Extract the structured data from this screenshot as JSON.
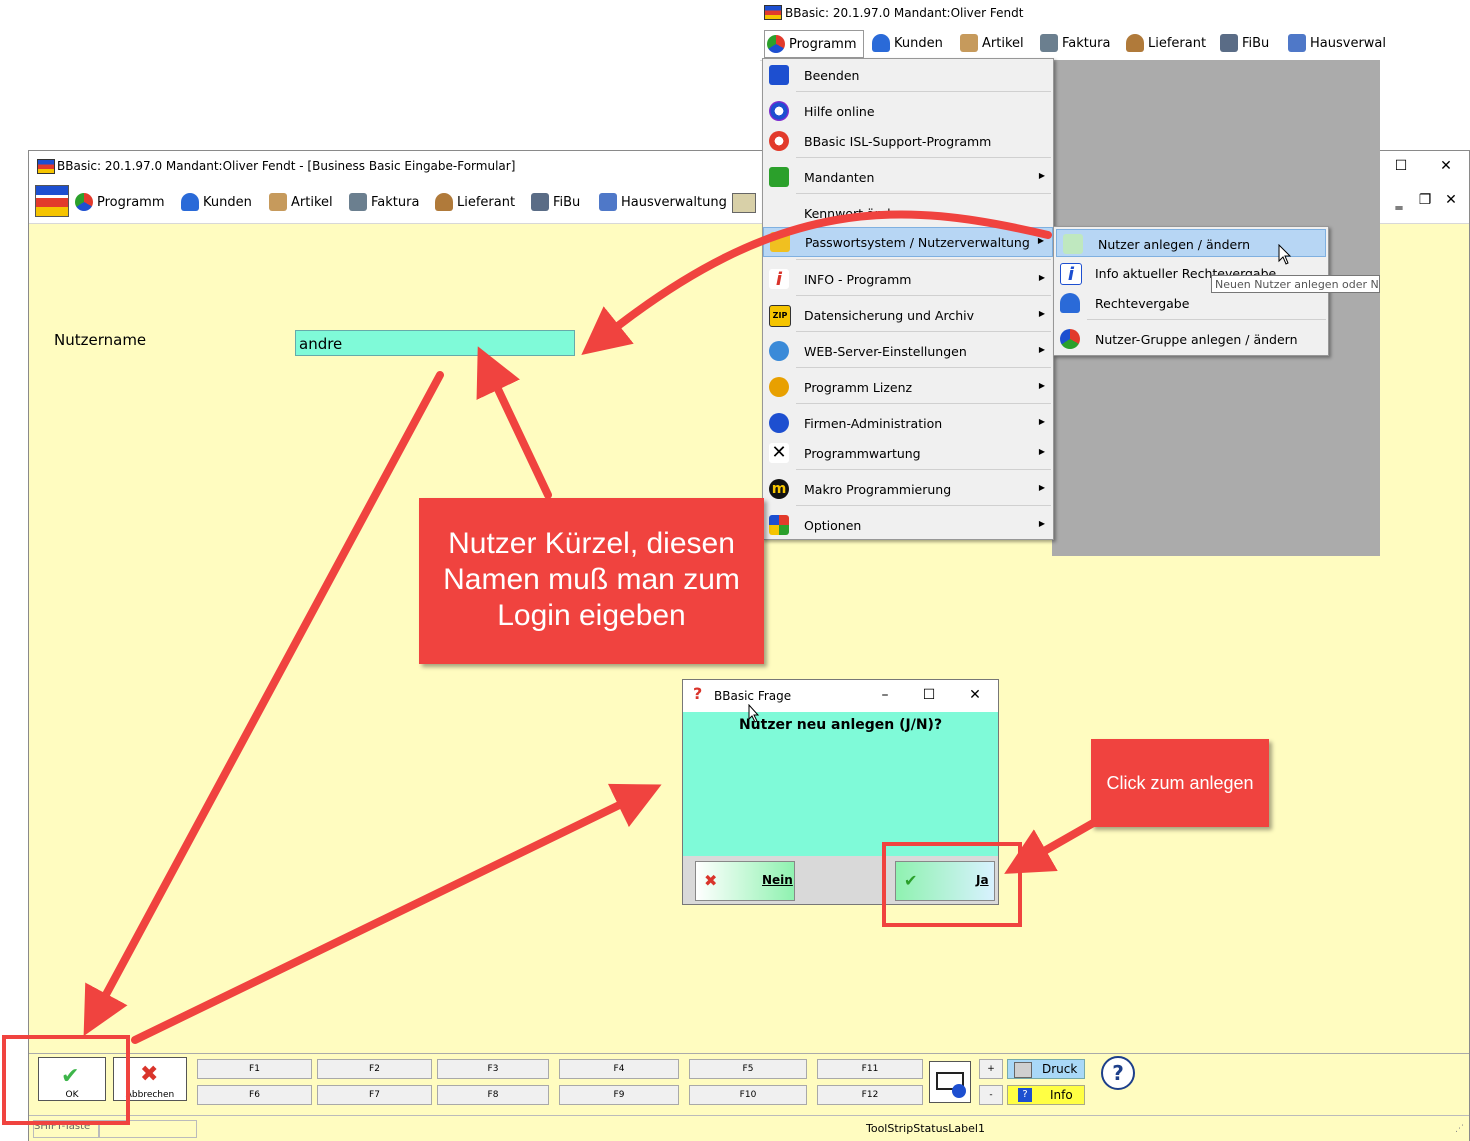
{
  "main_window": {
    "title": "BBasic: 20.1.97.0 Mandant:Oliver Fendt  - [Business Basic Eingabe-Formular]",
    "toolbar": [
      "Programm",
      "Kunden",
      "Artikel",
      "Faktura",
      "Lieferant",
      "FiBu",
      "Hausverwaltung"
    ],
    "form": {
      "label": "Nutzername",
      "value": "andre"
    },
    "buttons": {
      "ok": "OK",
      "cancel": "Abbrechen"
    },
    "fkeys_top": [
      "F1",
      "F2",
      "F3",
      "F4",
      "F5",
      "F11"
    ],
    "fkeys_bottom": [
      "F6",
      "F7",
      "F8",
      "F9",
      "F10",
      "F12"
    ],
    "plus": "+",
    "minus": "-",
    "druck": "Druck",
    "info": "Info",
    "status": {
      "left": "SHIFT-Taste",
      "right": "ToolStripStatusLabel1"
    }
  },
  "menu_window": {
    "title": "BBasic: 20.1.97.0 Mandant:Oliver Fendt",
    "toolbar": [
      "Programm",
      "Kunden",
      "Artikel",
      "Faktura",
      "Lieferant",
      "FiBu",
      "Hausverwal"
    ],
    "menu": [
      "Beenden",
      "Hilfe online",
      "BBasic ISL-Support-Programm",
      "Mandanten",
      "Kennwort ändern",
      "Passwortsystem / Nutzerverwaltung",
      "INFO - Programm",
      "Datensicherung und Archiv",
      "WEB-Server-Einstellungen",
      "Programm Lizenz",
      "Firmen-Administration",
      "Programmwartung",
      "Makro Programmierung",
      "Optionen"
    ],
    "submenu": [
      "Nutzer anlegen / ändern",
      "Info aktueller Rechtevergabe",
      "Rechtevergabe",
      "Nutzer-Gruppe anlegen / ändern"
    ],
    "tooltip": "Neuen Nutzer anlegen oder Nut"
  },
  "dialog": {
    "title": "BBasic Frage",
    "question": "Nutzer neu anlegen (J/N)?",
    "no": "Nein",
    "yes": "Ja"
  },
  "annotations": {
    "callout_main": "Nutzer Kürzel, diesen Namen muß man zum Login eigeben",
    "callout_click": "Click zum anlegen"
  },
  "colors": {
    "annotation": "#f0433f",
    "form_bg": "#fffcc0",
    "field": "#7ffad8",
    "highlight": "#b7d6f4"
  }
}
